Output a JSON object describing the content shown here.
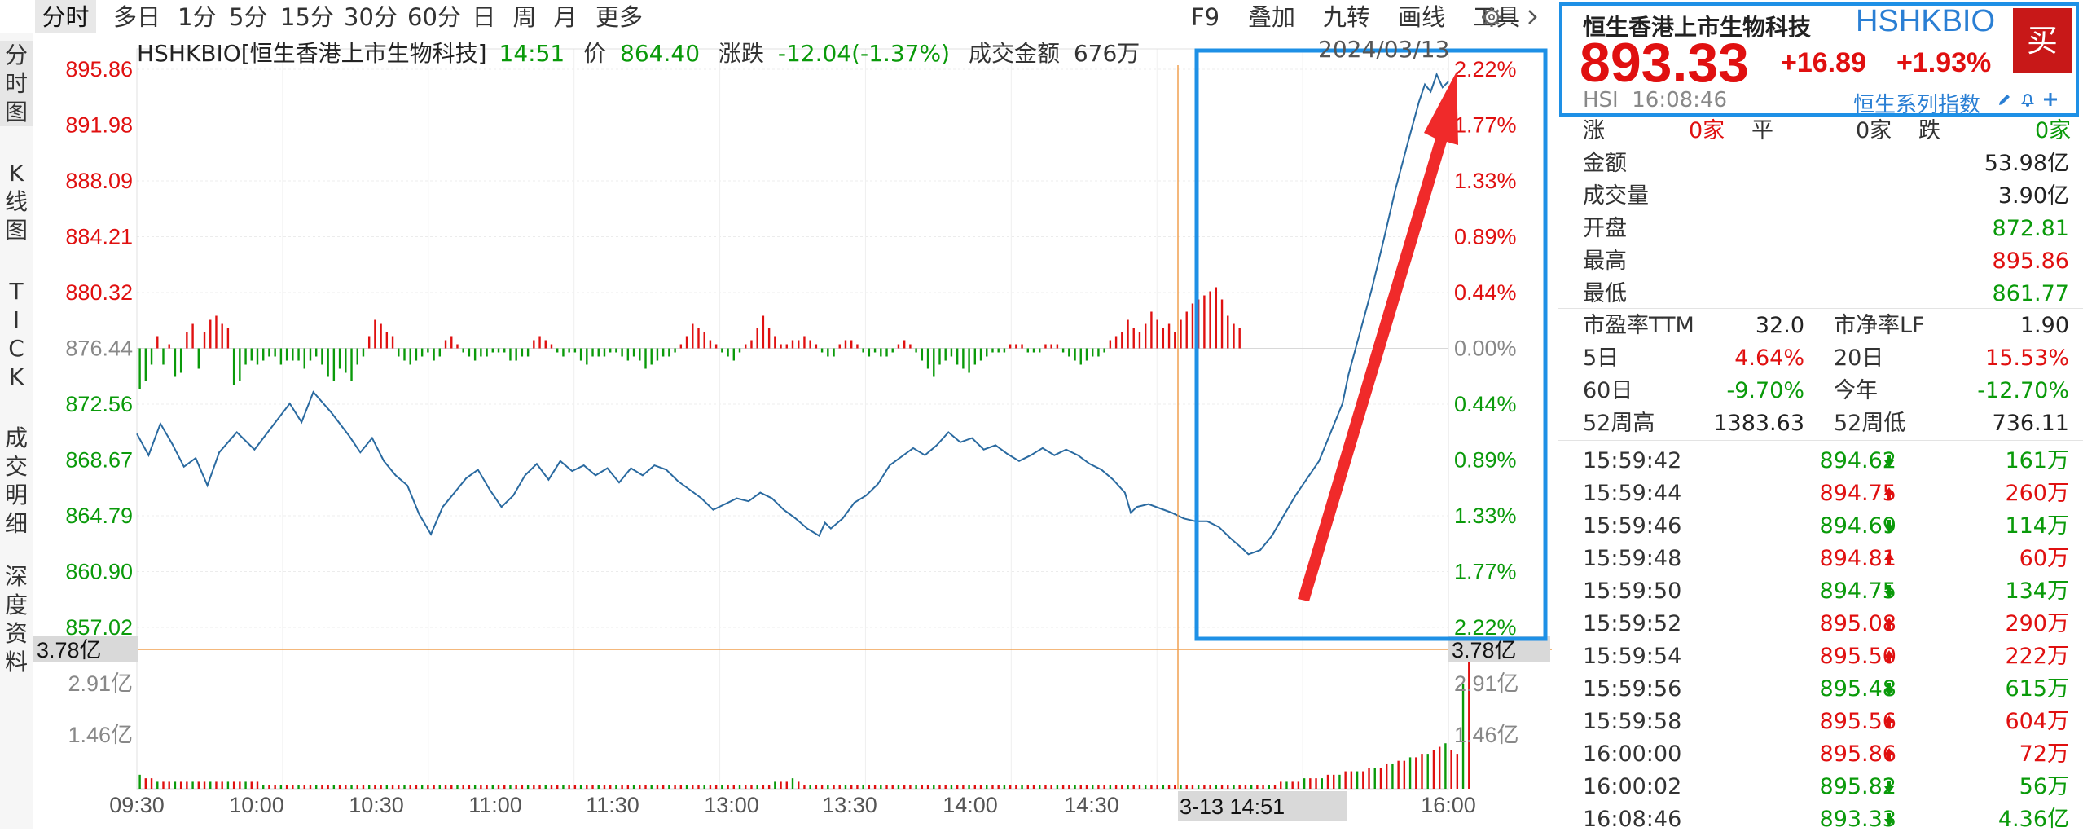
{
  "colors": {
    "up": "#e01010",
    "down": "#0a9a0a",
    "price_line": "#2a6aa0",
    "highlight": "#1e90e6",
    "arrow": "#f02a2a",
    "crosshair": "#f0a050"
  },
  "toolbar": {
    "periods": [
      "分时",
      "多日",
      "1分",
      "5分",
      "15分",
      "30分",
      "60分",
      "日",
      "周",
      "月",
      "更多"
    ],
    "active": "分时",
    "tools": [
      "F9",
      "叠加",
      "九转",
      "画线",
      "工具"
    ],
    "icons": [
      "gear-icon",
      "chevron-right-icon"
    ]
  },
  "left_tabs": [
    "分时图",
    "K线图",
    "TICK",
    "成交明细",
    "深度资料"
  ],
  "info_bar": {
    "code": "HSHKBIO",
    "name": "[恒生香港上市生物科技]",
    "time": "14:51",
    "price_label": "价",
    "price": "864.40",
    "change_label": "涨跌",
    "change": "-12.04(-1.37%)",
    "turnover_label": "成交金额",
    "turnover": "676万",
    "date": "2024/03/13"
  },
  "chart_data": {
    "type": "line",
    "base": 876.44,
    "price_ticks": [
      "895.86",
      "891.98",
      "888.09",
      "884.21",
      "880.32",
      "876.44",
      "872.56",
      "868.67",
      "864.79",
      "860.90",
      "857.02"
    ],
    "pct_ticks": [
      "2.22%",
      "1.77%",
      "1.33%",
      "0.89%",
      "0.44%",
      "0.00%",
      "0.44%",
      "0.89%",
      "1.33%",
      "1.77%",
      "2.22%"
    ],
    "volume_ticks": [
      "3.78亿",
      "2.91亿",
      "1.46亿"
    ],
    "time_ticks": [
      "09:30",
      "10:00",
      "10:30",
      "11:00",
      "11:30",
      "13:00",
      "13:30",
      "14:00",
      "14:30",
      "16:00"
    ],
    "crosshair_time": "3-13 14:51",
    "crosshair_volume": "3.78亿",
    "ylim": [
      857.02,
      895.86
    ],
    "price_points": [
      [
        0,
        870.5
      ],
      [
        2,
        869.0
      ],
      [
        4,
        871.2
      ],
      [
        6,
        869.8
      ],
      [
        8,
        868.2
      ],
      [
        10,
        868.8
      ],
      [
        12,
        866.9
      ],
      [
        14,
        869.2
      ],
      [
        17,
        870.6
      ],
      [
        20,
        869.4
      ],
      [
        23,
        871.0
      ],
      [
        26,
        872.6
      ],
      [
        28,
        871.3
      ],
      [
        30,
        873.4
      ],
      [
        33,
        872.0
      ],
      [
        36,
        870.4
      ],
      [
        38,
        869.2
      ],
      [
        40,
        870.2
      ],
      [
        42,
        868.6
      ],
      [
        44,
        867.6
      ],
      [
        46,
        866.9
      ],
      [
        48,
        864.9
      ],
      [
        50,
        863.5
      ],
      [
        52,
        865.4
      ],
      [
        54,
        866.4
      ],
      [
        56,
        867.4
      ],
      [
        58,
        868.0
      ],
      [
        60,
        866.6
      ],
      [
        62,
        865.4
      ],
      [
        64,
        866.2
      ],
      [
        66,
        867.6
      ],
      [
        68,
        868.4
      ],
      [
        70,
        867.3
      ],
      [
        72,
        868.6
      ],
      [
        74,
        867.9
      ],
      [
        76,
        868.3
      ],
      [
        78,
        867.6
      ],
      [
        80,
        868.1
      ],
      [
        82,
        867.1
      ],
      [
        84,
        868.1
      ],
      [
        86,
        867.6
      ],
      [
        88,
        868.3
      ],
      [
        90,
        868.0
      ],
      [
        92,
        867.2
      ],
      [
        94,
        866.6
      ],
      [
        96,
        866.0
      ],
      [
        98,
        865.2
      ],
      [
        100,
        865.6
      ],
      [
        102,
        866.0
      ],
      [
        104,
        865.8
      ],
      [
        106,
        866.4
      ],
      [
        108,
        866.0
      ],
      [
        110,
        865.2
      ],
      [
        112,
        864.6
      ],
      [
        114,
        863.9
      ],
      [
        116,
        863.4
      ],
      [
        117,
        864.3
      ],
      [
        118,
        863.9
      ],
      [
        120,
        864.6
      ],
      [
        122,
        865.7
      ],
      [
        124,
        866.2
      ],
      [
        126,
        867.0
      ],
      [
        128,
        868.3
      ],
      [
        130,
        868.9
      ],
      [
        132,
        869.5
      ],
      [
        134,
        869.0
      ],
      [
        136,
        869.7
      ],
      [
        138,
        870.6
      ],
      [
        140,
        869.9
      ],
      [
        142,
        870.2
      ],
      [
        144,
        869.4
      ],
      [
        146,
        869.7
      ],
      [
        148,
        869.1
      ],
      [
        150,
        868.6
      ],
      [
        152,
        869.0
      ],
      [
        154,
        869.5
      ],
      [
        156,
        869.0
      ],
      [
        158,
        869.4
      ],
      [
        160,
        869.0
      ],
      [
        162,
        868.4
      ],
      [
        164,
        868.0
      ],
      [
        166,
        867.3
      ],
      [
        168,
        866.4
      ],
      [
        169,
        865.0
      ],
      [
        170,
        865.4
      ],
      [
        172,
        865.6
      ],
      [
        174,
        865.3
      ],
      [
        176,
        865.0
      ],
      [
        178,
        864.6
      ],
      [
        180,
        864.4
      ],
      [
        182,
        864.4
      ],
      [
        184,
        864.0
      ],
      [
        186,
        863.2
      ],
      [
        188,
        862.5
      ],
      [
        189,
        862.1
      ],
      [
        191,
        862.4
      ],
      [
        193,
        863.4
      ],
      [
        195,
        864.8
      ],
      [
        197,
        866.2
      ],
      [
        199,
        867.4
      ],
      [
        201,
        868.6
      ],
      [
        203,
        870.6
      ],
      [
        205,
        872.6
      ],
      [
        206,
        874.6
      ],
      [
        208,
        877.6
      ],
      [
        210,
        880.6
      ],
      [
        212,
        884.0
      ],
      [
        214,
        887.5
      ],
      [
        216,
        890.6
      ],
      [
        218,
        893.6
      ],
      [
        219,
        894.8
      ],
      [
        220,
        894.3
      ],
      [
        221,
        895.5
      ],
      [
        222,
        894.6
      ],
      [
        223,
        895.0
      ]
    ],
    "volume_bars": [
      4,
      3,
      3,
      2,
      2,
      2,
      2,
      2,
      2,
      2,
      2,
      2,
      2,
      2,
      2,
      2,
      2,
      2,
      2,
      2,
      2,
      1,
      1,
      1,
      1,
      1,
      1,
      1,
      1,
      1,
      1,
      1,
      1,
      1,
      1,
      1,
      1,
      1,
      1,
      1,
      1,
      1,
      1,
      1,
      1,
      1,
      1,
      1,
      1,
      1,
      1,
      1,
      1,
      1,
      1,
      1,
      1,
      1,
      1,
      1,
      1,
      1,
      1,
      1,
      1,
      1,
      1,
      1,
      1,
      1,
      1,
      1,
      1,
      1,
      1,
      1,
      1,
      1,
      1,
      1,
      1,
      1,
      1,
      1,
      1,
      1,
      1,
      1,
      1,
      1,
      1,
      1,
      1,
      1,
      1,
      1,
      1,
      1,
      1,
      1,
      1,
      1,
      1,
      1,
      1,
      1,
      1,
      1,
      2,
      2,
      2,
      3,
      2,
      1,
      1,
      1,
      1,
      1,
      1,
      1,
      1,
      1,
      1,
      1,
      1,
      1,
      1,
      1,
      1,
      1,
      1,
      1,
      1,
      1,
      1,
      1,
      1,
      1,
      1,
      1,
      1,
      1,
      1,
      1,
      1,
      1,
      1,
      1,
      1,
      1,
      1,
      1,
      1,
      1,
      1,
      1,
      1,
      1,
      1,
      1,
      1,
      1,
      1,
      1,
      1,
      1,
      1,
      1,
      1,
      1,
      1,
      1,
      1,
      1,
      1,
      1,
      1,
      1,
      1,
      1,
      1,
      1,
      1,
      1,
      1,
      1,
      1,
      1,
      1,
      1,
      1,
      1,
      1,
      1,
      2,
      2,
      2,
      2,
      3,
      3,
      3,
      3,
      4,
      4,
      4,
      5,
      5,
      5,
      5,
      6,
      6,
      6,
      7,
      7,
      8,
      8,
      9,
      9,
      10,
      10,
      11,
      12,
      13,
      11,
      10,
      30,
      38
    ],
    "flow_bars": [
      -50,
      -40,
      -20,
      15,
      -20,
      5,
      -35,
      -30,
      20,
      30,
      -25,
      20,
      35,
      40,
      30,
      25,
      -45,
      -40,
      -20,
      -15,
      -20,
      -15,
      -10,
      -10,
      -20,
      -15,
      -15,
      -15,
      -25,
      -15,
      -10,
      -20,
      -35,
      -40,
      -25,
      -30,
      -40,
      -20,
      -10,
      15,
      35,
      30,
      20,
      15,
      -10,
      -15,
      -20,
      -15,
      -10,
      -5,
      -15,
      -10,
      10,
      15,
      5,
      -5,
      -10,
      -15,
      -10,
      -10,
      -5,
      -5,
      -5,
      -15,
      -15,
      -10,
      -10,
      10,
      15,
      10,
      5,
      -5,
      -10,
      -5,
      -5,
      -15,
      -20,
      -10,
      -10,
      -10,
      -5,
      -5,
      -10,
      -15,
      -10,
      -15,
      -25,
      -20,
      -15,
      -10,
      -10,
      -5,
      5,
      15,
      30,
      25,
      20,
      10,
      5,
      -5,
      -10,
      -15,
      -5,
      5,
      10,
      25,
      40,
      25,
      15,
      5,
      5,
      10,
      10,
      15,
      10,
      5,
      -5,
      -10,
      -10,
      5,
      10,
      10,
      5,
      -5,
      -10,
      -5,
      -10,
      -10,
      -5,
      5,
      10,
      5,
      -5,
      -15,
      -25,
      -35,
      -20,
      -15,
      -10,
      -20,
      -25,
      -30,
      -20,
      -15,
      -10,
      -5,
      -5,
      -5,
      5,
      5,
      5,
      -5,
      -5,
      -5,
      5,
      5,
      5,
      -5,
      -10,
      -15,
      -20,
      -15,
      -10,
      -10,
      -5,
      10,
      15,
      20,
      35,
      25,
      20,
      30,
      45,
      35,
      25,
      30,
      20,
      35,
      45,
      55,
      60,
      65,
      70,
      75,
      60,
      40,
      30,
      25
    ]
  },
  "right_panel": {
    "title": "恒生香港上市生物科技",
    "code": "HSHKBIO",
    "buy_label": "买",
    "price": "893.33",
    "change": "+16.89",
    "change_pct": "+1.93%",
    "exchange_time": "HSI  16:08:46",
    "series_link": "恒生系列指数",
    "adv_dec": {
      "up_label": "涨",
      "up_val": "0家",
      "flat_label": "平",
      "flat_val": "0家",
      "down_label": "跌",
      "down_val": "0家"
    },
    "stats": [
      {
        "label": "金额",
        "value": "53.98亿",
        "color": "#222222"
      },
      {
        "label": "成交量",
        "value": "3.90亿",
        "color": "#222222"
      },
      {
        "label": "开盘",
        "value": "872.81",
        "color": "#0a9a0a"
      },
      {
        "label": "最高",
        "value": "895.86",
        "color": "#e01010"
      },
      {
        "label": "最低",
        "value": "861.77",
        "color": "#0a9a0a"
      }
    ],
    "valuation": [
      {
        "l1": "市盈率TTM",
        "v1": "32.0",
        "l2": "市净率LF",
        "v2": "1.90",
        "c1": "#222222",
        "c2": "#222222"
      },
      {
        "l1": "5日",
        "v1": "4.64%",
        "l2": "20日",
        "v2": "15.53%",
        "c1": "#e01010",
        "c2": "#e01010"
      },
      {
        "l1": "60日",
        "v1": "-9.70%",
        "l2": "今年",
        "v2": "-12.70%",
        "c1": "#0a9a0a",
        "c2": "#0a9a0a"
      },
      {
        "l1": "52周高",
        "v1": "1383.63",
        "l2": "52周低",
        "v2": "736.11",
        "c1": "#222222",
        "c2": "#222222"
      }
    ],
    "ticks": [
      {
        "time": "15:59:42",
        "price": "894.62",
        "dir": "down",
        "vol": "161万"
      },
      {
        "time": "15:59:44",
        "price": "894.75",
        "dir": "up",
        "vol": "260万"
      },
      {
        "time": "15:59:46",
        "price": "894.69",
        "dir": "down",
        "vol": "114万"
      },
      {
        "time": "15:59:48",
        "price": "894.81",
        "dir": "up",
        "vol": "60万"
      },
      {
        "time": "15:59:50",
        "price": "894.75",
        "dir": "down",
        "vol": "134万"
      },
      {
        "time": "15:59:52",
        "price": "895.08",
        "dir": "up",
        "vol": "290万"
      },
      {
        "time": "15:59:54",
        "price": "895.50",
        "dir": "up",
        "vol": "222万"
      },
      {
        "time": "15:59:56",
        "price": "895.48",
        "dir": "down",
        "vol": "615万"
      },
      {
        "time": "15:59:58",
        "price": "895.56",
        "dir": "up",
        "vol": "604万"
      },
      {
        "time": "16:00:00",
        "price": "895.86",
        "dir": "up",
        "vol": "72万"
      },
      {
        "time": "16:00:02",
        "price": "895.82",
        "dir": "down",
        "vol": "56万"
      },
      {
        "time": "16:08:46",
        "price": "893.33",
        "dir": "down",
        "vol": "4.36亿"
      }
    ]
  }
}
